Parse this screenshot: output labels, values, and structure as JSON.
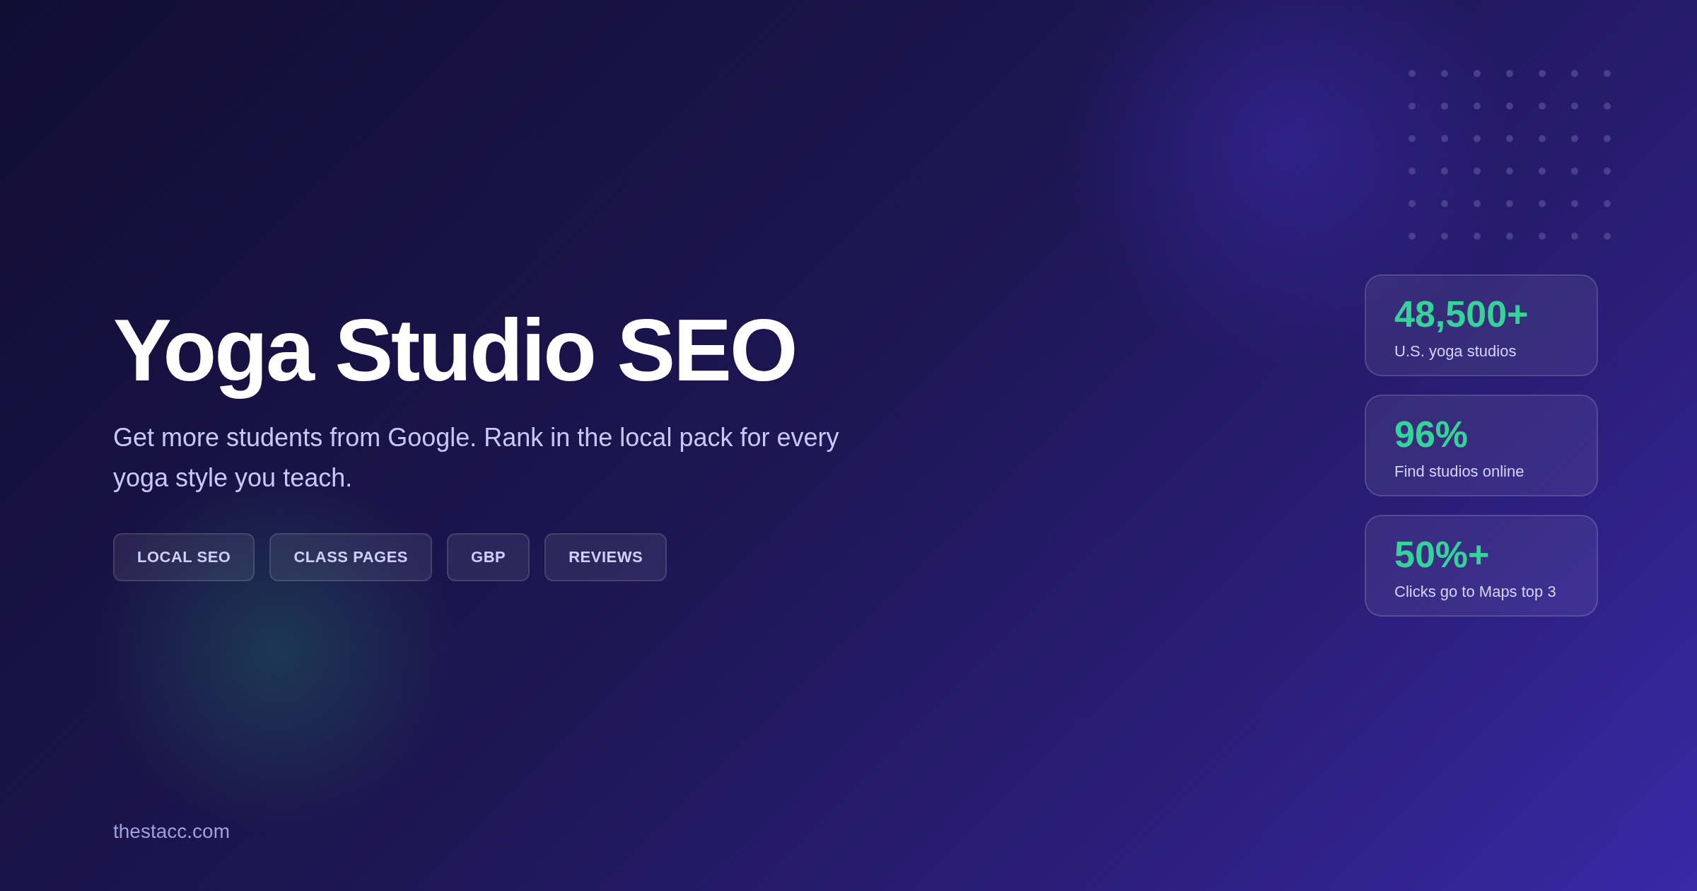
{
  "title": "Yoga Studio SEO",
  "subtitle": "Get more students from Google. Rank in the local pack for every yoga style you teach.",
  "tags": [
    "LOCAL SEO",
    "CLASS PAGES",
    "GBP",
    "REVIEWS"
  ],
  "stats": [
    {
      "value": "48,500+",
      "label": "U.S. yoga studios"
    },
    {
      "value": "96%",
      "label": "Find studios online"
    },
    {
      "value": "50%+",
      "label": "Clicks go to Maps top 3"
    }
  ],
  "footer": "thestacc.com"
}
